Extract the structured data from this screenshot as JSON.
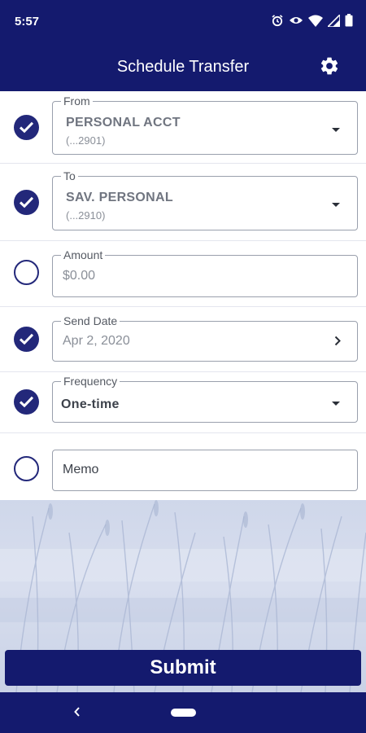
{
  "status_bar": {
    "time": "5:57"
  },
  "app_bar": {
    "title": "Schedule Transfer",
    "settings_icon": "gear-icon"
  },
  "form": {
    "from": {
      "legend": "From",
      "value": "PERSONAL ACCT",
      "sub": "(...2901)",
      "checked": true
    },
    "to": {
      "legend": "To",
      "value": "SAV. PERSONAL",
      "sub": "(...2910)",
      "checked": true
    },
    "amount": {
      "legend": "Amount",
      "placeholder": "$0.00",
      "checked": false
    },
    "send_date": {
      "legend": "Send Date",
      "value": "Apr 2, 2020",
      "checked": true
    },
    "frequency": {
      "legend": "Frequency",
      "value": "One-time",
      "checked": true
    },
    "memo": {
      "placeholder": "Memo",
      "checked": false
    }
  },
  "submit_label": "Submit",
  "colors": {
    "primary": "#141a6e",
    "check": "#23287a",
    "border": "#9aa0ad"
  }
}
